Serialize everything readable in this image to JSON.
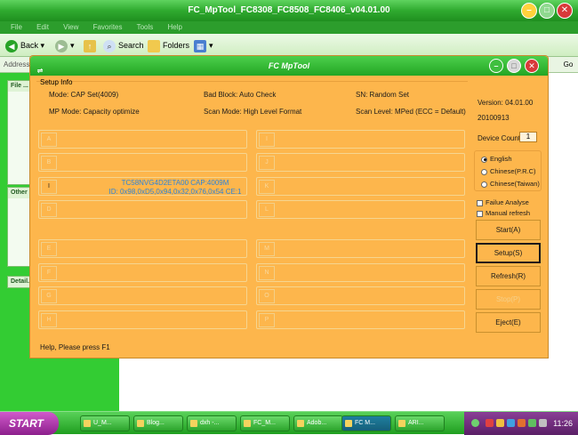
{
  "explorer": {
    "title": "FC_MpTool_FC8308_FC8508_FC8406_v04.01.00",
    "menu": [
      "File",
      "Edit",
      "View",
      "Favorites",
      "Tools",
      "Help"
    ],
    "toolbar": {
      "back": "Back",
      "search": "Search",
      "folders": "Folders"
    },
    "address_label": "Address",
    "go_label": "Go",
    "side_panels": [
      "File ...",
      "Other ...",
      "Detail..."
    ]
  },
  "mptool": {
    "title": "FC MpTool",
    "setup_info_legend": "Setup Info",
    "mode": "Mode: CAP Set(4009)",
    "bad_block": "Bad Block: Auto Check",
    "sn": "SN: Random Set",
    "mp_mode": "MP Mode: Capacity optimize",
    "scan_mode": "Scan Mode: High Level Format",
    "scan_level": "Scan Level: MPed (ECC = Default)",
    "version": "Version: 04.01.00",
    "date": "20100913",
    "device_count_label": "Device Count:",
    "device_count": "1",
    "active_port_label": "I",
    "port_detail_line1": "TC58NVG4D2ETA00 CAP:4009M",
    "port_detail_line2": "ID: 0x98,0xD5,0x94,0x32,0x76,0x54  CE:1",
    "languages": [
      "English",
      "Chinese(P.R.C)",
      "Chinese(Taiwan)"
    ],
    "selected_language": "English",
    "failure_analyse": "Failue Analyse",
    "manual_refresh": "Manual refresh",
    "buttons": {
      "start": "Start(A)",
      "setup": "Setup(S)",
      "refresh": "Refresh(R)",
      "stop": "Stop(P)",
      "eject": "Eject(E)"
    },
    "status": "Help, Please press F1"
  },
  "taskbar": {
    "start": "START",
    "tasks": [
      "U_M...",
      "Blog...",
      "dxh -...",
      "FC_M...",
      "Adob...",
      "FC M...",
      "ARI..."
    ],
    "active_task": "FC M...",
    "clock": "11:26"
  },
  "colors": {
    "window_body": "#fdb64c",
    "title_green": "#23a523",
    "start_purple": "#8c1f8c",
    "detail_blue": "#2d84d8"
  }
}
